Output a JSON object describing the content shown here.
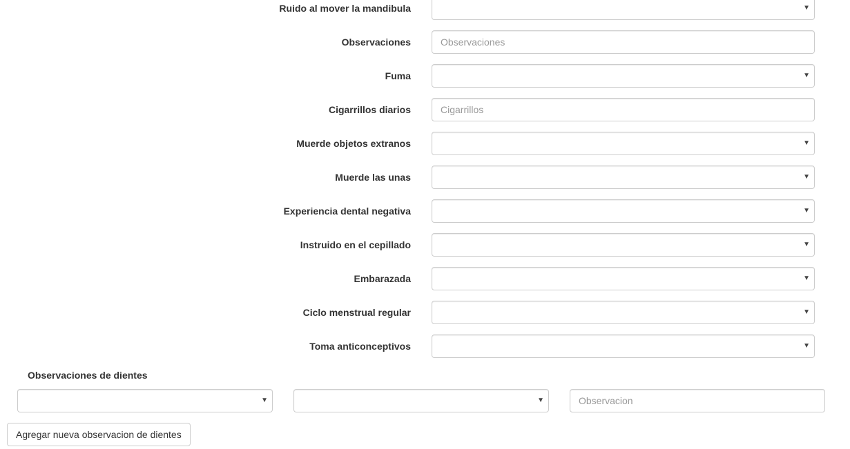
{
  "form": {
    "fields": [
      {
        "label": "Ruido al mover la mandibula",
        "type": "select",
        "value": ""
      },
      {
        "label": "Observaciones",
        "type": "text",
        "value": "",
        "placeholder": "Observaciones"
      },
      {
        "label": "Fuma",
        "type": "select",
        "value": ""
      },
      {
        "label": "Cigarrillos diarios",
        "type": "text",
        "value": "",
        "placeholder": "Cigarrillos"
      },
      {
        "label": "Muerde objetos extranos",
        "type": "select",
        "value": ""
      },
      {
        "label": "Muerde las unas",
        "type": "select",
        "value": ""
      },
      {
        "label": "Experiencia dental negativa",
        "type": "select",
        "value": ""
      },
      {
        "label": "Instruido en el cepillado",
        "type": "select",
        "value": ""
      },
      {
        "label": "Embarazada",
        "type": "select",
        "value": ""
      },
      {
        "label": "Ciclo menstrual regular",
        "type": "select",
        "value": ""
      },
      {
        "label": "Toma anticonceptivos",
        "type": "select",
        "value": ""
      }
    ],
    "dropdown_icon": "chevron-down-icon",
    "dropdown_glyph": "▼"
  },
  "teeth_section": {
    "title": "Observaciones de dientes",
    "select_1_value": "",
    "select_2_value": "",
    "observation_value": "",
    "observation_placeholder": "Observacion",
    "add_button_label": "Agregar nueva observacion de dientes"
  },
  "colors": {
    "border": "#cccccc",
    "label_text": "#333333",
    "placeholder_text": "#999999",
    "background": "#ffffff"
  }
}
